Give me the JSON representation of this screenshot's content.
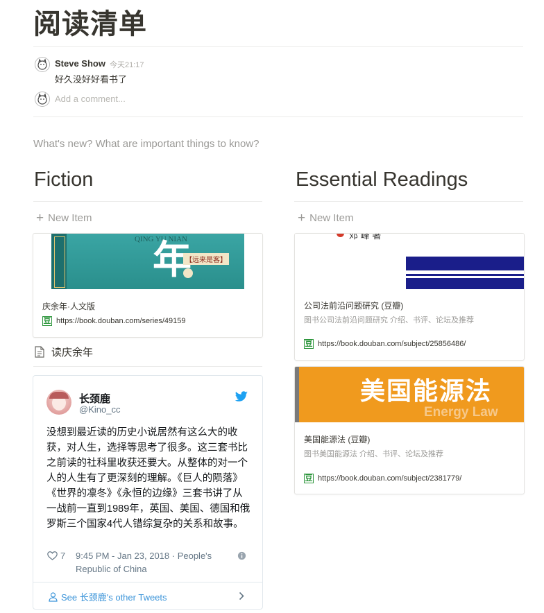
{
  "page": {
    "title": "阅读清单",
    "prompt": "What's new? What are important things to know?"
  },
  "comments": {
    "author": "Steve Show",
    "time": "今天21:17",
    "text": "好久没好好看书了",
    "add_placeholder": "Add a comment..."
  },
  "fiction": {
    "heading": "Fiction",
    "new_item": "New Item",
    "card": {
      "title": "庆余年·人文版",
      "url": "https://book.douban.com/series/49159",
      "cover_text": "年",
      "cover_subtitle": "【远来是客】",
      "cover_pinyin": "QING YU NIAN"
    },
    "page_link": "读庆余年",
    "tweet": {
      "name": "长颈鹿",
      "handle": "@Kino_cc",
      "text": "没想到最近读的历史小说居然有这么大的收获，对人生，选择等思考了很多。这三套书比之前读的社科里收获还要大。从整体的对一个人的人生有了更深刻的理解。《巨人的陨落》《世界的凛冬》《永恒的边缘》三套书讲了从一战前一直到1989年，英国、美国、德国和俄罗斯三个国家4代人错综复杂的关系和故事。",
      "likes": "7",
      "timestamp": "9:45 PM - Jan 23, 2018 · People's Republic of China",
      "see_more": "See 长颈鹿's other Tweets"
    }
  },
  "essential": {
    "heading": "Essential Readings",
    "new_item": "New Item",
    "cards": [
      {
        "title": "公司法前沿问题研究 (豆瓣)",
        "desc": "图书公司法前沿问题研究 介绍、书评、论坛及推荐",
        "url": "https://book.douban.com/subject/25856486/",
        "cover_text": "邓 峰 著"
      },
      {
        "title": "美国能源法 (豆瓣)",
        "desc": "图书美国能源法 介绍、书评、论坛及推荐",
        "url": "https://book.douban.com/subject/2381779/",
        "cover_title": "美国能源法",
        "cover_subtitle": "Energy Law"
      }
    ]
  },
  "icons": {
    "avatar": "cat-avatar-icon",
    "plus": "plus-icon",
    "page": "page-icon",
    "douban": "douban-icon",
    "twitter": "twitter-bird-icon",
    "heart": "heart-icon",
    "info": "info-icon",
    "user": "user-icon",
    "chevron": "chevron-right-icon"
  },
  "colors": {
    "text": "#37352f",
    "muted": "#9b9a97",
    "twitter_blue": "#1da1f2",
    "douban_green": "#2e963d",
    "energy_orange": "#f09a1e"
  }
}
